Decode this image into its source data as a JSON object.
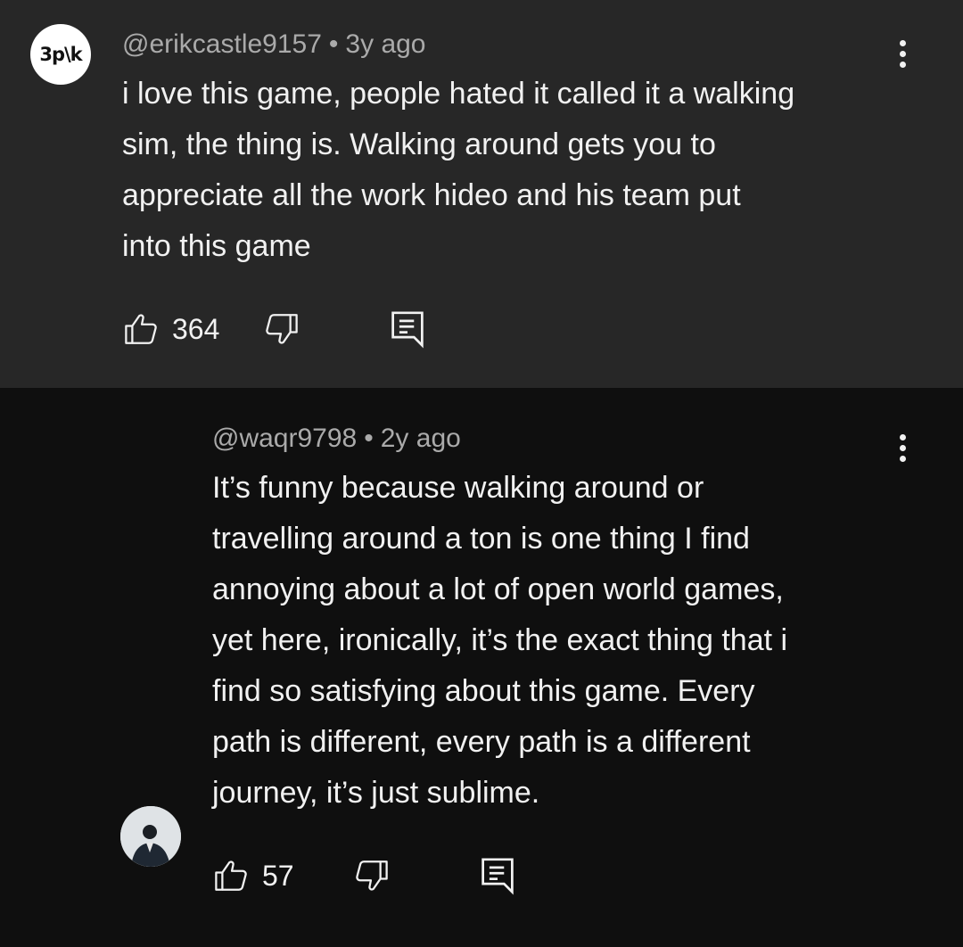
{
  "comment": {
    "avatar_text": "3p\\k",
    "handle": "@erikcastle9157",
    "time": "3y ago",
    "text": "i love this game, people hated it called it a walking\nsim, the thing is. Walking around gets you to\nappreciate all the work hideo and his team put\ninto this game",
    "likes": "364",
    "icons": {
      "like": "thumbs-up-icon",
      "dislike": "thumbs-down-icon",
      "reply": "reply-comment-icon",
      "more": "more-vert-icon"
    }
  },
  "reply": {
    "handle": "@waqr9798",
    "time": "2y ago",
    "text": "It’s funny because walking around or\ntravelling around a ton is one thing I find\nannoying about a lot of open world games,\nyet here, ironically, it’s the exact thing that i\nfind so satisfying about this game. Every\npath is different, every path is a different\njourney, it’s just sublime.",
    "likes": "57",
    "icons": {
      "like": "thumbs-up-icon",
      "dislike": "thumbs-down-icon",
      "reply": "reply-comment-icon",
      "more": "more-vert-icon"
    }
  },
  "colors": {
    "top_background": "#272727",
    "reply_background": "#0f0f0f",
    "text": "#f1f1f1",
    "meta": "#aaaaaa"
  },
  "meta_separator": "•"
}
